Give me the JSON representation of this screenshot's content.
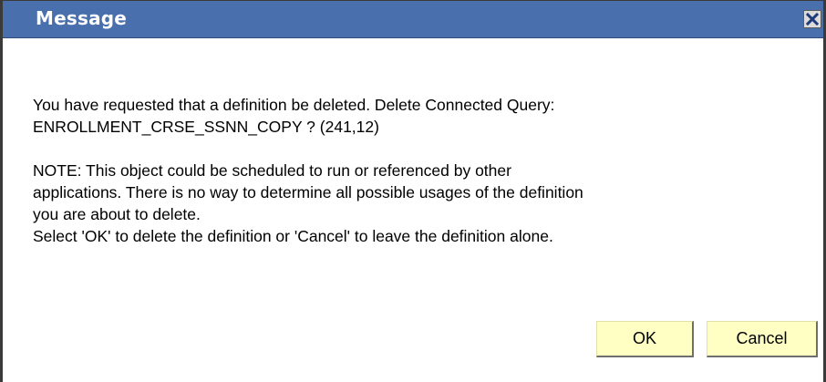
{
  "dialog": {
    "title": "Message",
    "close_icon": "close-icon",
    "titlebar_color": "#4a6fad",
    "message_lines": [
      "You have requested that a definition be deleted.  Delete Connected Query:",
      "ENROLLMENT_CRSE_SSNN_COPY ? (241,12)"
    ],
    "note_lines": [
      "NOTE:  This object could be scheduled to run or referenced by other",
      "applications. There is no way to determine all possible usages of the definition",
      "you are about to delete.",
      "Select 'OK' to delete the definition or 'Cancel' to leave the definition alone."
    ],
    "buttons": {
      "ok_label": "OK",
      "cancel_label": "Cancel",
      "button_color": "#ffffc4"
    }
  }
}
